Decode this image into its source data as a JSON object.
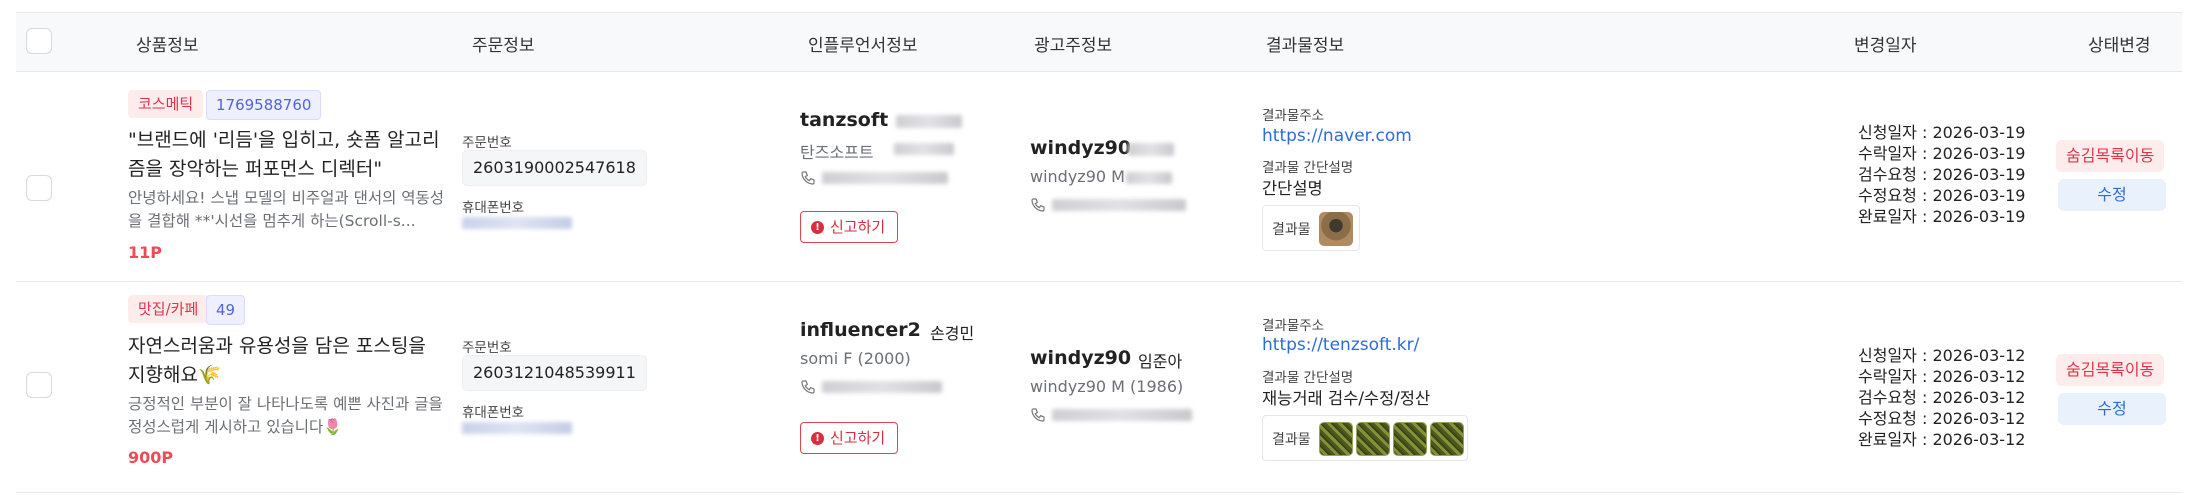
{
  "header": {
    "product": "상품정보",
    "order": "주문정보",
    "influencer": "인플루언서정보",
    "advertiser": "광고주정보",
    "result": "결과물정보",
    "changed": "변경일자",
    "status": "상태변경"
  },
  "labels": {
    "order_no": "주문번호",
    "phone": "휴대폰번호",
    "report": "신고하기",
    "result_url": "결과물주소",
    "result_desc": "결과물 간단설명",
    "result_item": "결과물",
    "hide_move": "숨김목록이동",
    "edit": "수정"
  },
  "rows": [
    {
      "category": "코스메틱",
      "product_id": "1769588760",
      "title": "\"브랜드에 '리듬'을 입히고, 숏폼 알고리즘을 장악하는 퍼포먼스 디렉터\"",
      "description": "안녕하세요! 스냅 모델의 비주얼과 댄서의 역동성을 결합해 **'시선을 멈추게 하는(Scroll-s...",
      "point": "11P",
      "order_no": "2603190002547618",
      "influencer_id": "tanzsoft",
      "influencer_real": "",
      "influencer_sub": "탄즈소프트",
      "advertiser_id": "windyz90",
      "advertiser_real": "",
      "advertiser_sub": "windyz90 M",
      "result_url": "https://naver.com",
      "result_desc": "간단설명",
      "result_thumbs": [
        "brown"
      ],
      "dates": [
        "신청일자 : 2026-03-19",
        "수락일자 : 2026-03-19",
        "검수요청 : 2026-03-19",
        "수정요청 : 2026-03-19",
        "완료일자 : 2026-03-19"
      ]
    },
    {
      "category": "맛집/카페",
      "product_id": "49",
      "title": "자연스러움과 유용성을 담은 포스팅을 지향해요🌾",
      "description": "긍정적인 부분이 잘 나타나도록 예쁜 사진과 글을 정성스럽게 게시하고 있습니다🌷",
      "point": "900P",
      "order_no": "2603121048539911",
      "influencer_id": "influencer2",
      "influencer_real": "손경민",
      "influencer_sub": "somi F (2000)",
      "advertiser_id": "windyz90",
      "advertiser_real": "임준아",
      "advertiser_sub": "windyz90 M (1986)",
      "result_url": "https://tenzsoft.kr/",
      "result_desc": "재능거래 검수/수정/정산",
      "result_thumbs": [
        "green",
        "green",
        "green",
        "green"
      ],
      "dates": [
        "신청일자 : 2026-03-12",
        "수락일자 : 2026-03-12",
        "검수요청 : 2026-03-12",
        "수정요청 : 2026-03-12",
        "완료일자 : 2026-03-12"
      ]
    }
  ]
}
